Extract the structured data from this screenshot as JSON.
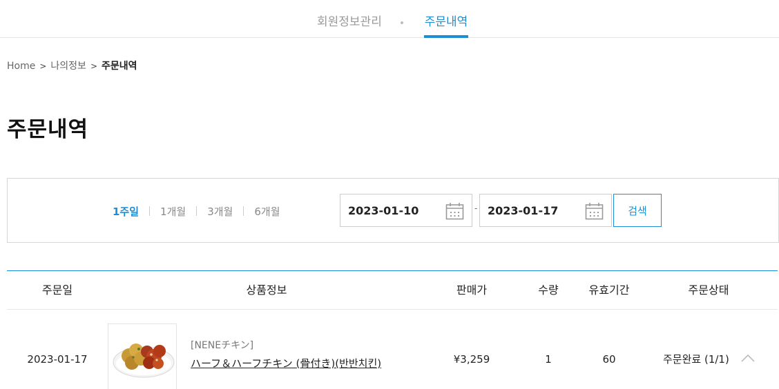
{
  "top_tabs": {
    "profile_label": "회원정보관리",
    "orders_label": "주문내역"
  },
  "breadcrumb": {
    "home": "Home",
    "separator": ">",
    "my_info": "나의정보",
    "current": "주문내역"
  },
  "page_title": "주문내역",
  "filter": {
    "periods": [
      "1주일",
      "1개월",
      "3개월",
      "6개월"
    ],
    "active_period": "1주일",
    "start_date": "2023-01-10",
    "date_separator": "-",
    "end_date": "2023-01-17",
    "search_label": "검색"
  },
  "table": {
    "headers": {
      "order_date": "주문일",
      "product_info": "상품정보",
      "price": "판매가",
      "quantity": "수량",
      "validity": "유효기간",
      "status": "주문상태"
    },
    "rows": [
      {
        "order_date": "2023-01-17",
        "thumbnail": "fried-chicken-image",
        "brand": "[NENEチキン]",
        "product_name": "ハーフ＆ハーフチキン (骨付き)(반반치킨)",
        "price": "¥3,259",
        "quantity": "1",
        "validity": "60",
        "status": "주문완료 (1/1)"
      }
    ]
  },
  "colors": {
    "accent": "#1a8fd8",
    "border": "#d6d6d6",
    "muted_text": "#888888"
  },
  "icons": {
    "calendar": "calendar-icon",
    "expand": "chevron-up-icon"
  }
}
